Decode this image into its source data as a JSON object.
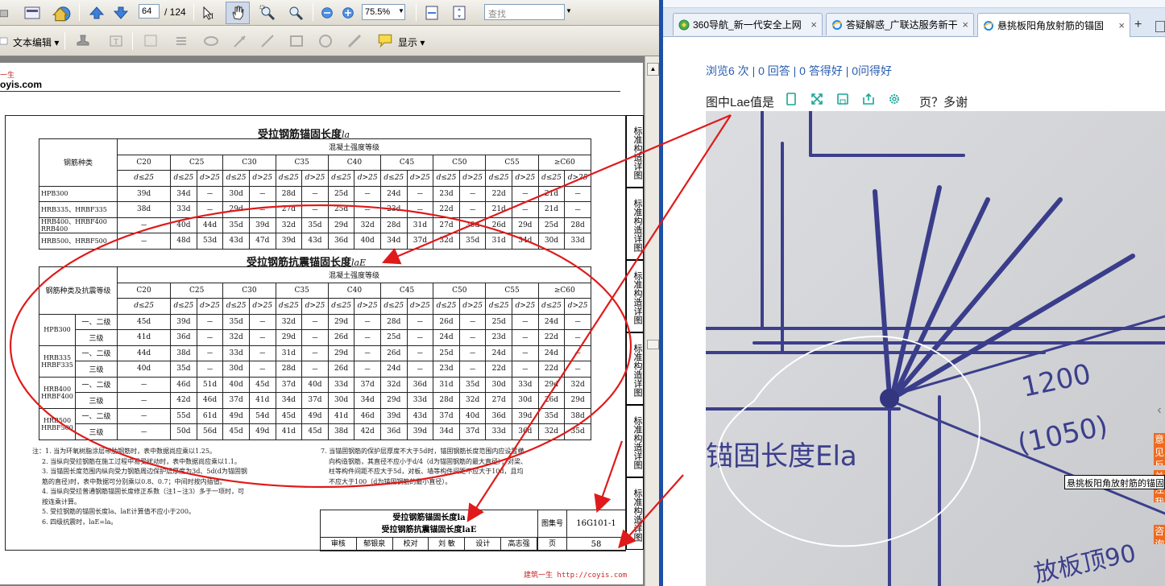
{
  "pdf": {
    "toolbar": {
      "page_value": "64",
      "page_total": "/ 124",
      "zoom_value": "75.5%",
      "find_placeholder": "查找",
      "text_edit_label": "文本编辑",
      "display_label": "显示"
    },
    "watermark_top": {
      "a": "一生",
      "b": "oyis.com"
    },
    "side_tabs": [
      "标准构造详图",
      "标准构造详图",
      "标准构造详图",
      "标准构造详图",
      "标准构造详图",
      "标准构造详图"
    ],
    "table1": {
      "title": "受拉钢筋锚固长度",
      "title_sym": "la",
      "group_header": "混凝土强度等级",
      "row_header": "钢筋种类",
      "grades": [
        "C20",
        "C25",
        "C30",
        "C35",
        "C40",
        "C45",
        "C50",
        "C55",
        "≥C60"
      ],
      "subheaders": [
        "d≤25",
        "d≤25",
        "d>25",
        "d≤25",
        "d>25",
        "d≤25",
        "d>25",
        "d≤25",
        "d>25",
        "d≤25",
        "d>25",
        "d≤25",
        "d>25",
        "d≤25",
        "d>25",
        "d≤25",
        "d>25"
      ],
      "rows": [
        {
          "name": "HPB300",
          "cells": [
            "39d",
            "34d",
            "－",
            "30d",
            "－",
            "28d",
            "－",
            "25d",
            "－",
            "24d",
            "－",
            "23d",
            "－",
            "22d",
            "－",
            "21d",
            "－"
          ]
        },
        {
          "name": "HRB335、HRBF335",
          "cells": [
            "38d",
            "33d",
            "－",
            "29d",
            "－",
            "27d",
            "－",
            "25d",
            "－",
            "23d",
            "－",
            "22d",
            "－",
            "21d",
            "－",
            "21d",
            "－"
          ]
        },
        {
          "name": "HRB400、HRBF400 RRB400",
          "cells": [
            "－",
            "40d",
            "44d",
            "35d",
            "39d",
            "32d",
            "35d",
            "29d",
            "32d",
            "28d",
            "31d",
            "27d",
            "30d",
            "26d",
            "29d",
            "25d",
            "28d"
          ]
        },
        {
          "name": "HRB500、HRBF500",
          "cells": [
            "－",
            "48d",
            "53d",
            "43d",
            "47d",
            "39d",
            "43d",
            "36d",
            "40d",
            "34d",
            "37d",
            "32d",
            "35d",
            "31d",
            "34d",
            "30d",
            "33d"
          ]
        }
      ]
    },
    "table2": {
      "title": "受拉钢筋抗震锚固长度",
      "title_sym": "laE",
      "group_header": "混凝土强度等级",
      "row_header": "钢筋种类及抗震等级",
      "grades": [
        "C20",
        "C25",
        "C30",
        "C35",
        "C40",
        "C45",
        "C50",
        "C55",
        "≥C60"
      ],
      "subheaders": [
        "d≤25",
        "d≤25",
        "d>25",
        "d≤25",
        "d>25",
        "d≤25",
        "d>25",
        "d≤25",
        "d>25",
        "d≤25",
        "d>25",
        "d≤25",
        "d>25",
        "d≤25",
        "d>25",
        "d≤25",
        "d>25"
      ],
      "groups": [
        {
          "name": "HPB300",
          "rows": [
            {
              "level": "一、二级",
              "cells": [
                "45d",
                "39d",
                "－",
                "35d",
                "－",
                "32d",
                "－",
                "29d",
                "－",
                "28d",
                "－",
                "26d",
                "－",
                "25d",
                "－",
                "24d",
                "－"
              ]
            },
            {
              "level": "三级",
              "cells": [
                "41d",
                "36d",
                "－",
                "32d",
                "－",
                "29d",
                "－",
                "26d",
                "－",
                "25d",
                "－",
                "24d",
                "－",
                "23d",
                "－",
                "22d",
                "－"
              ]
            }
          ]
        },
        {
          "name": "HRB335 HRBF335",
          "rows": [
            {
              "level": "一、二级",
              "cells": [
                "44d",
                "38d",
                "－",
                "33d",
                "－",
                "31d",
                "－",
                "29d",
                "－",
                "26d",
                "－",
                "25d",
                "－",
                "24d",
                "－",
                "24d",
                "－"
              ]
            },
            {
              "level": "三级",
              "cells": [
                "40d",
                "35d",
                "－",
                "30d",
                "－",
                "28d",
                "－",
                "26d",
                "－",
                "24d",
                "－",
                "23d",
                "－",
                "22d",
                "－",
                "22d",
                "－"
              ]
            }
          ]
        },
        {
          "name": "HRB400 HRBF400",
          "rows": [
            {
              "level": "一、二级",
              "cells": [
                "－",
                "46d",
                "51d",
                "40d",
                "45d",
                "37d",
                "40d",
                "33d",
                "37d",
                "32d",
                "36d",
                "31d",
                "35d",
                "30d",
                "33d",
                "29d",
                "32d"
              ]
            },
            {
              "level": "三级",
              "cells": [
                "－",
                "42d",
                "46d",
                "37d",
                "41d",
                "34d",
                "37d",
                "30d",
                "34d",
                "29d",
                "33d",
                "28d",
                "32d",
                "27d",
                "30d",
                "26d",
                "29d"
              ]
            }
          ]
        },
        {
          "name": "HRB500 HRBF500",
          "rows": [
            {
              "level": "一、二级",
              "cells": [
                "－",
                "55d",
                "61d",
                "49d",
                "54d",
                "45d",
                "49d",
                "41d",
                "46d",
                "39d",
                "43d",
                "37d",
                "40d",
                "36d",
                "39d",
                "35d",
                "38d"
              ]
            },
            {
              "level": "三级",
              "cells": [
                "－",
                "50d",
                "56d",
                "45d",
                "49d",
                "41d",
                "45d",
                "38d",
                "42d",
                "36d",
                "39d",
                "34d",
                "37d",
                "33d",
                "36d",
                "32d",
                "35d"
              ]
            }
          ]
        }
      ]
    },
    "notes_left": [
      "注：1. 当为环氧树脂涂层带肋钢筋时，表中数据尚应乘以1.25。",
      "2. 当纵向受拉钢筋在施工过程中易受扰动时，表中数据尚应乘以1.1。",
      "3. 当锚固长度范围内纵向受力钢筋周边保护层厚度为3d、5d(d为锚固钢",
      "筋的直径)时，表中数据可分别乘以0.8、0.7；中间时按内插值。",
      "4. 当纵向受拉普通钢筋锚固长度修正系数（注1~注3）多于一项时，可",
      "按连乘计算。",
      "5. 受拉钢筋的锚固长度la、laE计算值不应小于200。",
      "6. 四级抗震时，laE=la。"
    ],
    "notes_right": [
      "7. 当锚固钢筋的保护层厚度不大于5d时，锚固钢筋长度范围内应设置横",
      "向构造钢筋，其直径不应小于d/4（d为锚固钢筋的最大直径）；对梁、",
      "柱等构件间距不应大于5d，对板、墙等构件间距不应大于10d，且均",
      "不应大于100（d为锚固钢筋的最小直径）。"
    ],
    "titleblock": {
      "line1": "受拉钢筋锚固长度la",
      "line2": "受拉钢筋抗震锚固长度laE",
      "atlas_label": "图集号",
      "atlas_value": "16G101-1",
      "page_label": "页",
      "page_value": "58",
      "sign_row": [
        "审核",
        "郁银泉",
        "校对",
        "刘 敏",
        "设计",
        "高志强"
      ]
    },
    "footer_watermark": "建筑一生 http://coyis.com"
  },
  "browser": {
    "tabs": [
      {
        "label": "360导航_新一代安全上网",
        "active": false
      },
      {
        "label": "答疑解惑_广联达服务新干",
        "active": false
      },
      {
        "label": "悬挑板阳角放射筋的锚固",
        "active": true
      }
    ],
    "new_tab": "+",
    "stats": "浏览6 次 | 0 回答 | 0 答得好 | 0问得好",
    "question_head": "图中Lae值是",
    "question_tail": "页？多谢",
    "photo_text": {
      "dim1": "1200",
      "dim2": "(1050)",
      "label": "锚固长度Ela",
      "bottom": "放板顶90"
    },
    "side_buttons": [
      "意见反馈",
      "关注我们",
      "咨询"
    ],
    "tooltip": "悬挑板阳角放射筋的锚固"
  },
  "colors": {
    "annotation_red": "#e01a1a",
    "divider_blue": "#1b4fa8",
    "link_blue": "#2a5db0",
    "side_orange": "#ee6a1f"
  }
}
